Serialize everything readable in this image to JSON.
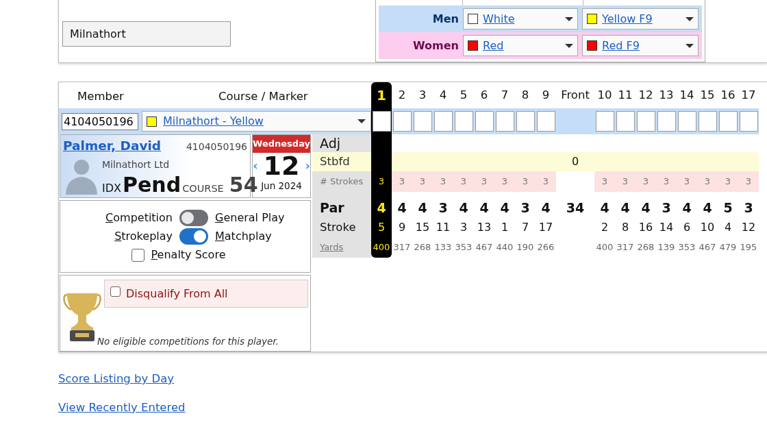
{
  "club_field": {
    "value": "Milnathort"
  },
  "tees": [
    {
      "group": "Men",
      "kind": "men",
      "selections": [
        {
          "label": "White",
          "color": "#ffffff"
        },
        {
          "label": "Yellow F9",
          "color": "#ffff00"
        }
      ]
    },
    {
      "group": "Women",
      "kind": "women",
      "selections": [
        {
          "label": "Red",
          "color": "#ff0000"
        },
        {
          "label": "Red F9",
          "color": "#ff0000"
        }
      ]
    }
  ],
  "scorecard": {
    "headings": {
      "member": "Member",
      "course": "Course / Marker"
    },
    "member_field": {
      "value": "4104050196"
    },
    "course_select": {
      "label": "Milnathort - Yellow",
      "color": "#ffff00"
    },
    "row_labels": {
      "adj": "Adj",
      "stbfd": "Stbfd",
      "strokes": "# Strokes",
      "par": "Par",
      "stroke": "Stroke",
      "yards": "Yards"
    },
    "holes": [
      {
        "kind": "hole",
        "label": "1",
        "selected": true,
        "strokes": "3",
        "par": "4",
        "stroke": "5",
        "yards": "400"
      },
      {
        "kind": "hole",
        "label": "2",
        "selected": false,
        "strokes": "3",
        "par": "4",
        "stroke": "9",
        "yards": "317"
      },
      {
        "kind": "hole",
        "label": "3",
        "selected": false,
        "strokes": "3",
        "par": "4",
        "stroke": "15",
        "yards": "268"
      },
      {
        "kind": "hole",
        "label": "4",
        "selected": false,
        "strokes": "3",
        "par": "3",
        "stroke": "11",
        "yards": "133"
      },
      {
        "kind": "hole",
        "label": "5",
        "selected": false,
        "strokes": "3",
        "par": "4",
        "stroke": "3",
        "yards": "353"
      },
      {
        "kind": "hole",
        "label": "6",
        "selected": false,
        "strokes": "3",
        "par": "4",
        "stroke": "13",
        "yards": "467"
      },
      {
        "kind": "hole",
        "label": "7",
        "selected": false,
        "strokes": "3",
        "par": "4",
        "stroke": "1",
        "yards": "440"
      },
      {
        "kind": "hole",
        "label": "8",
        "selected": false,
        "strokes": "3",
        "par": "3",
        "stroke": "7",
        "yards": "190"
      },
      {
        "kind": "hole",
        "label": "9",
        "selected": false,
        "strokes": "3",
        "par": "4",
        "stroke": "17",
        "yards": "266"
      },
      {
        "kind": "total",
        "label": "Front",
        "stbfd": "0",
        "par": "34"
      },
      {
        "kind": "hole",
        "label": "10",
        "selected": false,
        "strokes": "3",
        "par": "4",
        "stroke": "2",
        "yards": "400"
      },
      {
        "kind": "hole",
        "label": "11",
        "selected": false,
        "strokes": "3",
        "par": "4",
        "stroke": "8",
        "yards": "317"
      },
      {
        "kind": "hole",
        "label": "12",
        "selected": false,
        "strokes": "3",
        "par": "4",
        "stroke": "16",
        "yards": "268"
      },
      {
        "kind": "hole",
        "label": "13",
        "selected": false,
        "strokes": "3",
        "par": "3",
        "stroke": "14",
        "yards": "139"
      },
      {
        "kind": "hole",
        "label": "14",
        "selected": false,
        "strokes": "3",
        "par": "4",
        "stroke": "6",
        "yards": "353"
      },
      {
        "kind": "hole",
        "label": "15",
        "selected": false,
        "strokes": "3",
        "par": "4",
        "stroke": "10",
        "yards": "467"
      },
      {
        "kind": "hole",
        "label": "16",
        "selected": false,
        "strokes": "3",
        "par": "5",
        "stroke": "4",
        "yards": "479"
      },
      {
        "kind": "hole",
        "label": "17",
        "selected": false,
        "strokes": "3",
        "par": "3",
        "stroke": "12",
        "yards": "195"
      }
    ],
    "player": {
      "name": "Palmer, David",
      "id": "4104050196",
      "club": "Milnathort Ltd",
      "idx_label": "IDX",
      "idx_value": "Pend",
      "course_label": "COURSE",
      "course_value": "54"
    },
    "date": {
      "weekday": "Wednesday",
      "prev": "‹",
      "day": "12",
      "next": "›",
      "month_year": "Jun 2024"
    },
    "options": [
      {
        "kind": "switch",
        "left": "Competition",
        "right": "General Play",
        "on": false
      },
      {
        "kind": "switch",
        "left": "Strokeplay",
        "right": "Matchplay",
        "on": true
      },
      {
        "kind": "checkbox",
        "label": "Penalty Score",
        "checked": false
      }
    ],
    "disqualify": {
      "label": "Disqualify From All",
      "checked": false
    },
    "competitions_note": "No eligible competitions for this player."
  },
  "links": [
    "Score Listing by Day",
    "View Recently Entered"
  ]
}
